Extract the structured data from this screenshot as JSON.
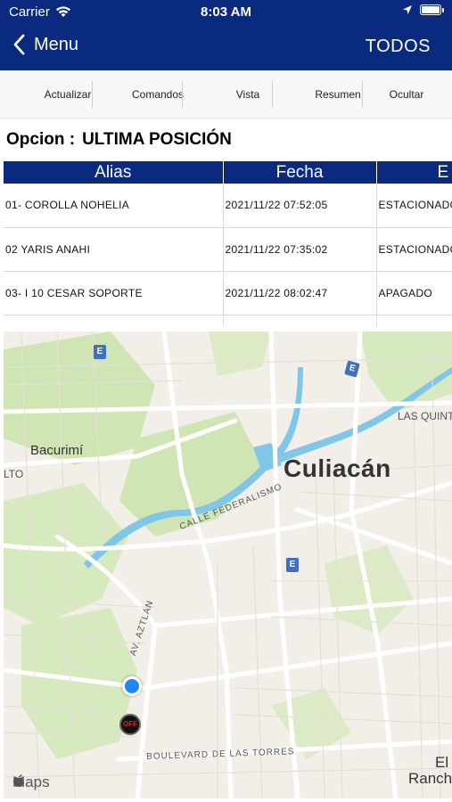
{
  "status": {
    "carrier": "Carrier",
    "time": "8:03 AM"
  },
  "nav": {
    "back_label": "Menu",
    "right_label": "TODOS"
  },
  "toolbar": {
    "items": [
      "Actualizar",
      "Comandos",
      "Vista",
      "Resumen",
      "Ocultar"
    ]
  },
  "option": {
    "label": "Opcion :",
    "value": "ULTIMA POSICIÓN"
  },
  "table": {
    "headers": [
      "Alias",
      "Fecha",
      "E"
    ],
    "rows": [
      [
        "01- COROLLA NOHELIA",
        "2021/11/22 07:52:05",
        "ESTACIONADO"
      ],
      [
        "02 YARIS ANAHI",
        "2021/11/22 07:35:02",
        "ESTACIONADO"
      ],
      [
        "03- I 10 CESAR SOPORTE",
        "2021/11/22 08:02:47",
        "APAGADO"
      ],
      [
        "",
        "",
        ""
      ]
    ]
  },
  "map": {
    "labels": {
      "city": "Culiacán",
      "bacurimi": "Bacurimí",
      "lto": "LTO",
      "las_quint": "LAS QUINT",
      "calle_federalismo": "CALLE FEDERALISMO",
      "av_aztlan": "AV. AZTLÁN",
      "blvd_torres": "BOULEVARD DE LAS TORRES",
      "el": "El",
      "ranch": "Ranch"
    },
    "poi_letter": "E",
    "car_marker_text": "OFF",
    "maps_logo": "Maps",
    "colors": {
      "water": "#7fc6e8",
      "park": "#cfe5b4",
      "road": "#ffffff",
      "land": "#f2efe9"
    }
  }
}
